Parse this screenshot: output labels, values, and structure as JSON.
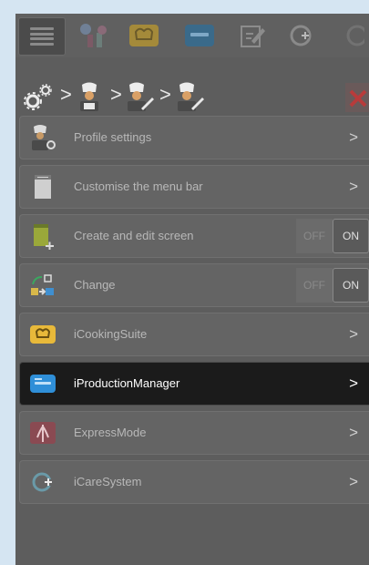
{
  "toolbar": {
    "icons": [
      "menu-icon",
      "chef-hat-icon",
      "cooking-suite-icon",
      "production-manager-icon",
      "edit-icon",
      "care-system-icon",
      "cycle-icon"
    ]
  },
  "breadcrumb": {
    "items": [
      "settings-icon",
      "chef-icon",
      "chef-edit-icon",
      "chef-edit-icon"
    ],
    "separator": ">"
  },
  "menu": {
    "items": [
      {
        "label": "Profile settings",
        "type": "chevron",
        "icon": "chef-settings-icon"
      },
      {
        "label": "Customise the menu bar",
        "type": "chevron",
        "icon": "menu-bar-icon"
      },
      {
        "label": "Create and edit screen",
        "type": "toggle",
        "off_label": "OFF",
        "on_label": "ON",
        "icon": "edit-screen-icon"
      },
      {
        "label": "Change",
        "type": "toggle",
        "off_label": "OFF",
        "on_label": "ON",
        "icon": "change-icon"
      },
      {
        "label": "iCookingSuite",
        "type": "chevron",
        "icon": "cooking-suite-icon"
      },
      {
        "label": "iProductionManager",
        "type": "chevron",
        "icon": "production-manager-icon",
        "selected": true
      },
      {
        "label": "ExpressMode",
        "type": "chevron",
        "icon": "express-mode-icon"
      },
      {
        "label": "iCareSystem",
        "type": "chevron",
        "icon": "care-system-icon"
      }
    ],
    "chevron": ">"
  },
  "colors": {
    "background": "#d5e5f2",
    "panel": "#5d5d5d",
    "selected_row": "#1b1b1b",
    "cooking_yellow": "#e8b93a",
    "production_blue": "#2f8fd8",
    "express_red": "#c8444c",
    "close_red": "#b83b3b"
  }
}
